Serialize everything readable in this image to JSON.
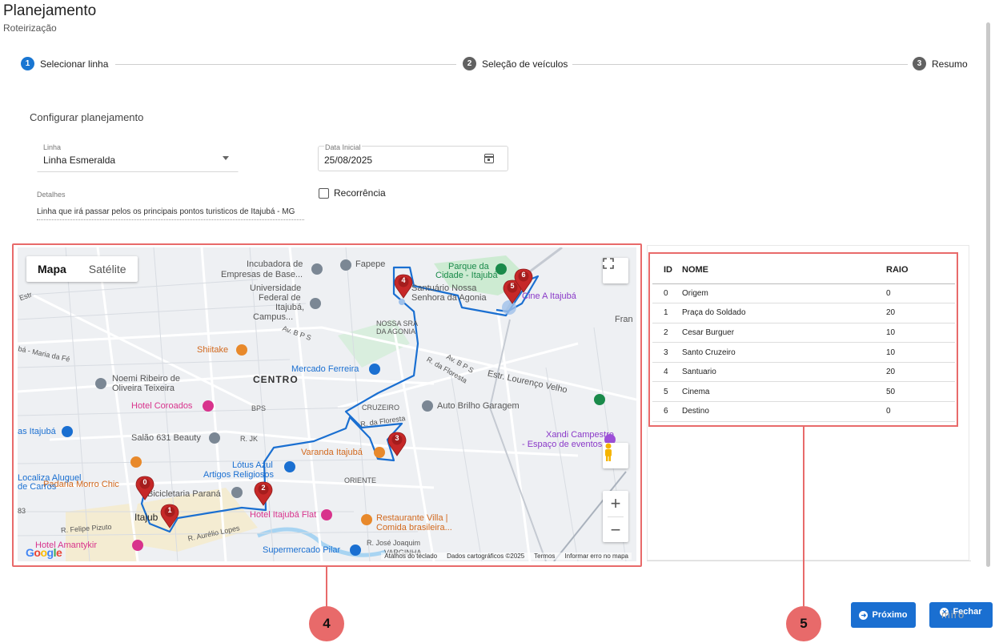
{
  "header": {
    "title": "Planejamento",
    "subtitle": "Roteirização"
  },
  "stepper": [
    {
      "num": "1",
      "label": "Selecionar linha",
      "active": true
    },
    {
      "num": "2",
      "label": "Seleção de veículos",
      "active": false
    },
    {
      "num": "3",
      "label": "Resumo",
      "active": false
    }
  ],
  "form": {
    "section_title": "Configurar planejamento",
    "linha": {
      "label": "Linha",
      "value": "Linha Esmeralda"
    },
    "data_inicial": {
      "label": "Data Inicial",
      "value": "25/08/2025"
    },
    "detalhes": {
      "label": "Detalhes",
      "value": "Linha que irá passar pelos os principais pontos turisticos de Itajubá - MG"
    },
    "recorrencia": {
      "label": "Recorrência",
      "checked": false
    }
  },
  "map": {
    "toggle": {
      "map": "Mapa",
      "satellite": "Satélite"
    },
    "labels": {
      "incubadora": "Incubadora de",
      "incubadora2": "Empresas de Base...",
      "fapepe": "Fapepe",
      "parque": "Parque da",
      "parque2": "Cidade - Itajubá",
      "santuario": "Santuário Nossa",
      "santuario2": "Senhora da Agonia",
      "cine": "Cine A Itajubá",
      "universidade": "Universidade",
      "universidade2": "Federal de",
      "universidade3": "Itajubá,",
      "universidade4": "Campus...",
      "nossa_sra": "NOSSA SRA",
      "da_agonia": "DA AGONIA",
      "fran": "Fran",
      "shiitake": "Shiitake",
      "mercado": "Mercado Ferreira",
      "centro": "CENTRO",
      "noemi": "Noemi Ribeiro de",
      "noemi2": "Oliveira Teixeira",
      "hotel_coroados": "Hotel Coroados",
      "bps": "BPS",
      "cruzeiro": "CRUZEIRO",
      "auto_brilho": "Auto Brilho Garagem",
      "estr_lorenco": "Estr. Lourenço Velho",
      "xandi": "Xandi Campestre",
      "xandi2": "- Espaço de eventos e...",
      "as_itajuba": "as Itajubá",
      "salao": "Salão 631 Beauty",
      "rjk": "R. JK",
      "r_floresta": "R. da Floresta",
      "r_floresta2": "R. da Floresta",
      "av_bps": "Av. B P S",
      "av_bps2": "Av. B P S",
      "varanda": "Varanda Itajubá",
      "padaria": "Padaria Morro Chic",
      "lotus": "Lótus Azul",
      "artigos": "Artigos Religiosos",
      "oriente": "ORIENTE",
      "localiza": "Localiza Aluguel",
      "localiza2": "de Carros",
      "bicicletaria": "Bicicletaria Paraná",
      "itajuba": "Itajub",
      "hotel_flat": "Hotel Itajubá Flat",
      "restaurante": "Restaurante Villa |",
      "restaurante2": "Comida brasileira...",
      "felipe": "R. Felipe Pizuto",
      "aurelio": "R. Aurélio Lopes",
      "hotel_amantykir": "Hotel Amantykir",
      "supermercado": "Supermercado Pilar",
      "jose_joaquim": "R. José Joaquim",
      "varginha": "VARGINHA",
      "maria_fe": "bá - Maria da Fé",
      "estr": "Estr",
      "num83": "83"
    },
    "footer": {
      "atalhos": "Atalhos do teclado",
      "dados": "Dados cartográficos ©2025",
      "termos": "Termos",
      "erro": "Informar erro no mapa"
    },
    "google": "Google",
    "markers": [
      {
        "label": "0"
      },
      {
        "label": "1"
      },
      {
        "label": "2"
      },
      {
        "label": "3"
      },
      {
        "label": "4"
      },
      {
        "label": "5"
      },
      {
        "label": "6"
      }
    ],
    "accent_marker": "#c62828",
    "route_color": "#1a6fd1"
  },
  "table": {
    "headers": {
      "id": "ID",
      "name": "NOME",
      "raio": "RAIO"
    },
    "rows": [
      {
        "id": "0",
        "name": "Origem",
        "raio": "0"
      },
      {
        "id": "1",
        "name": "Praça do Soldado",
        "raio": "20"
      },
      {
        "id": "2",
        "name": "Cesar Burguer",
        "raio": "10"
      },
      {
        "id": "3",
        "name": "Santo Cruzeiro",
        "raio": "10"
      },
      {
        "id": "4",
        "name": "Santuario",
        "raio": "20"
      },
      {
        "id": "5",
        "name": "Cinema",
        "raio": "50"
      },
      {
        "id": "6",
        "name": "Destino",
        "raio": "0"
      }
    ]
  },
  "buttons": {
    "proximo": "Próximo",
    "fechar": "Fechar"
  },
  "watermark": "miro",
  "callouts": {
    "map": "4",
    "table": "5"
  },
  "colors": {
    "primary": "#1a6fd1",
    "callout": "#e86a6a",
    "step_inactive": "#616161"
  }
}
